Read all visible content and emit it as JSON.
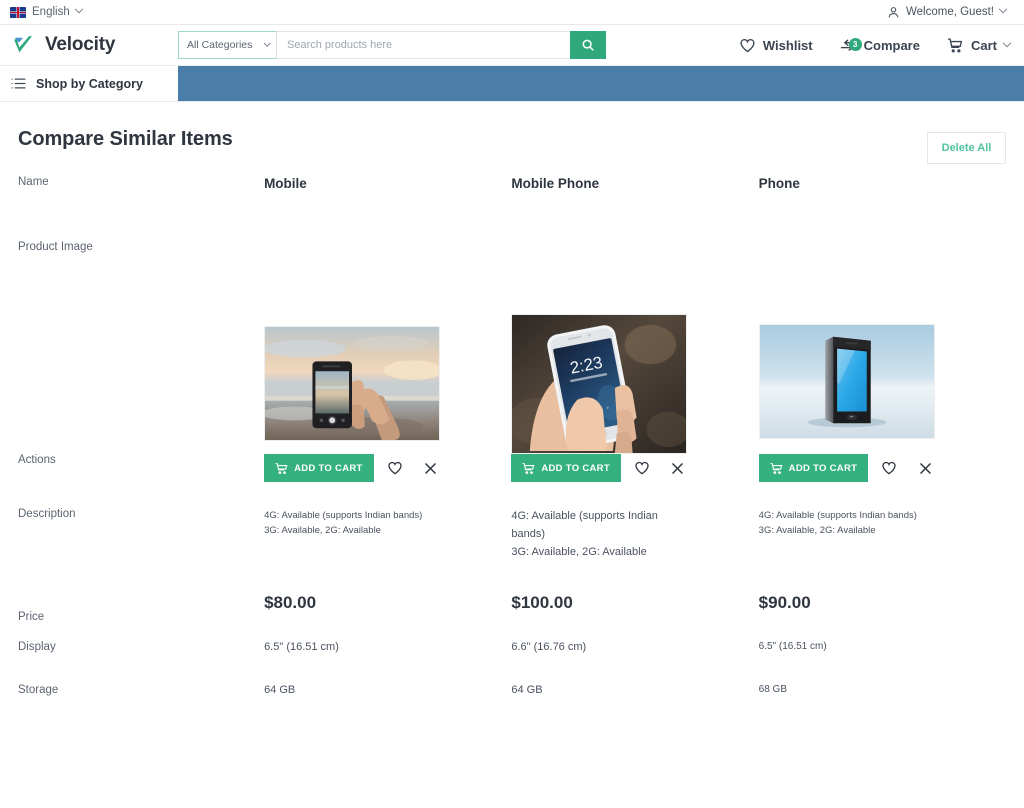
{
  "topbar": {
    "language": "English",
    "flag_icon": "uk-flag-icon",
    "welcome": "Welcome, Guest!",
    "user_icon": "user-icon",
    "chevron_icon": "chevron-down-icon"
  },
  "header": {
    "brand": "Velocity",
    "logo_icon": "velocity-check-logo",
    "search": {
      "category_value": "All Categories",
      "placeholder": "Search products here",
      "value": "",
      "search_icon": "search-icon"
    },
    "actions": [
      {
        "label": "Wishlist",
        "icon": "heart-icon",
        "badge": ""
      },
      {
        "label": "Compare",
        "icon": "compare-arrows-icon",
        "badge": "3"
      },
      {
        "label": "Cart",
        "icon": "cart-icon",
        "badge": ""
      }
    ]
  },
  "catbar": {
    "label": "Shop by Category",
    "icon": "hamburger-list-icon",
    "banner_color": "#4a7da7"
  },
  "page": {
    "title": "Compare Similar Items",
    "delete_all_label": "Delete All"
  },
  "row_labels": {
    "name": "Name",
    "product_image": "Product Image",
    "actions": "Actions",
    "description": "Description",
    "price": "Price",
    "display": "Display",
    "storage": "Storage"
  },
  "actions_labels": {
    "add_to_cart": "ADD TO CART",
    "cart_icon": "cart-icon",
    "wishlist_icon": "heart-icon",
    "remove_icon": "close-x-icon"
  },
  "products": [
    {
      "name": "Mobile",
      "image_alt": "hand-holding-phone-at-beach-sunset",
      "description_line1": "4G: Available (supports Indian bands)",
      "description_line2": "3G: Available, 2G: Available",
      "price": "$80.00",
      "display": "6.5\" (16.51 cm)",
      "storage": "64 GB"
    },
    {
      "name": "Mobile Phone",
      "image_alt": "hand-holding-white-smartphone-lockscreen-2-23",
      "description_line1": "4G: Available (supports Indian bands)",
      "description_line2": "3G: Available, 2G: Available",
      "price": "$100.00",
      "display": "6.6\" (16.76 cm)",
      "storage": "64 GB"
    },
    {
      "name": "Phone",
      "image_alt": "black-smartphone-3d-render-blue-screen",
      "description_line1": "4G: Available (supports Indian bands)",
      "description_line2": "3G: Available, 2G: Available",
      "price": "$90.00",
      "display": "6.5\" (16.51 cm)",
      "storage": "68 GB"
    }
  ],
  "colors": {
    "accent_green": "#35b07f",
    "banner_blue": "#4a7da7",
    "delete_text": "#4ec3a0",
    "text_dark": "#2f3640"
  }
}
